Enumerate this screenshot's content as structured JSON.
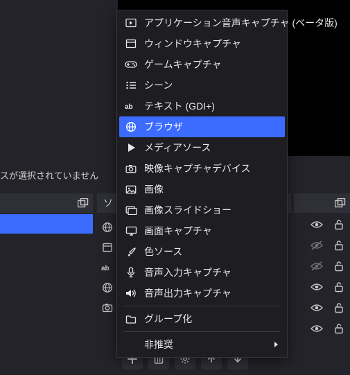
{
  "status": {
    "no_selection": "スが選択されていません"
  },
  "panels": {
    "sources_title": "ソ"
  },
  "side_icons": [
    "globe",
    "window",
    "ab",
    "globe",
    "camera"
  ],
  "right_rows": [
    {
      "eye": "open",
      "lock": "unlocked"
    },
    {
      "eye": "hidden",
      "lock": "unlocked"
    },
    {
      "eye": "hidden",
      "lock": "unlocked"
    },
    {
      "eye": "open",
      "lock": "unlocked"
    },
    {
      "eye": "open",
      "lock": "unlocked"
    },
    {
      "eye": "open",
      "lock": "unlocked"
    }
  ],
  "toolbar": [
    "add",
    "remove",
    "gear",
    "up",
    "down"
  ],
  "menu": {
    "items": [
      {
        "icon": "app-audio",
        "label": "アプリケーション音声キャプチャ (ベータ版)"
      },
      {
        "icon": "window",
        "label": "ウィンドウキャプチャ"
      },
      {
        "icon": "gamepad",
        "label": "ゲームキャプチャ"
      },
      {
        "icon": "list",
        "label": "シーン"
      },
      {
        "icon": "ab",
        "label": "テキスト (GDI+)"
      },
      {
        "icon": "globe",
        "label": "ブラウザ",
        "highlighted": true
      },
      {
        "icon": "play",
        "label": "メディアソース"
      },
      {
        "icon": "camera",
        "label": "映像キャプチャデバイス"
      },
      {
        "icon": "image",
        "label": "画像"
      },
      {
        "icon": "slideshow",
        "label": "画像スライドショー"
      },
      {
        "icon": "monitor",
        "label": "画面キャプチャ"
      },
      {
        "icon": "brush",
        "label": "色ソース"
      },
      {
        "icon": "mic",
        "label": "音声入力キャプチャ"
      },
      {
        "icon": "speaker",
        "label": "音声出力キャプチャ"
      }
    ],
    "group": {
      "icon": "folder",
      "label": "グループ化"
    },
    "deprecated": {
      "label": "非推奨"
    }
  },
  "colors": {
    "accent": "#3b6cff",
    "menu_bg": "#1d1d22",
    "panel_bg": "#2f2f37"
  }
}
